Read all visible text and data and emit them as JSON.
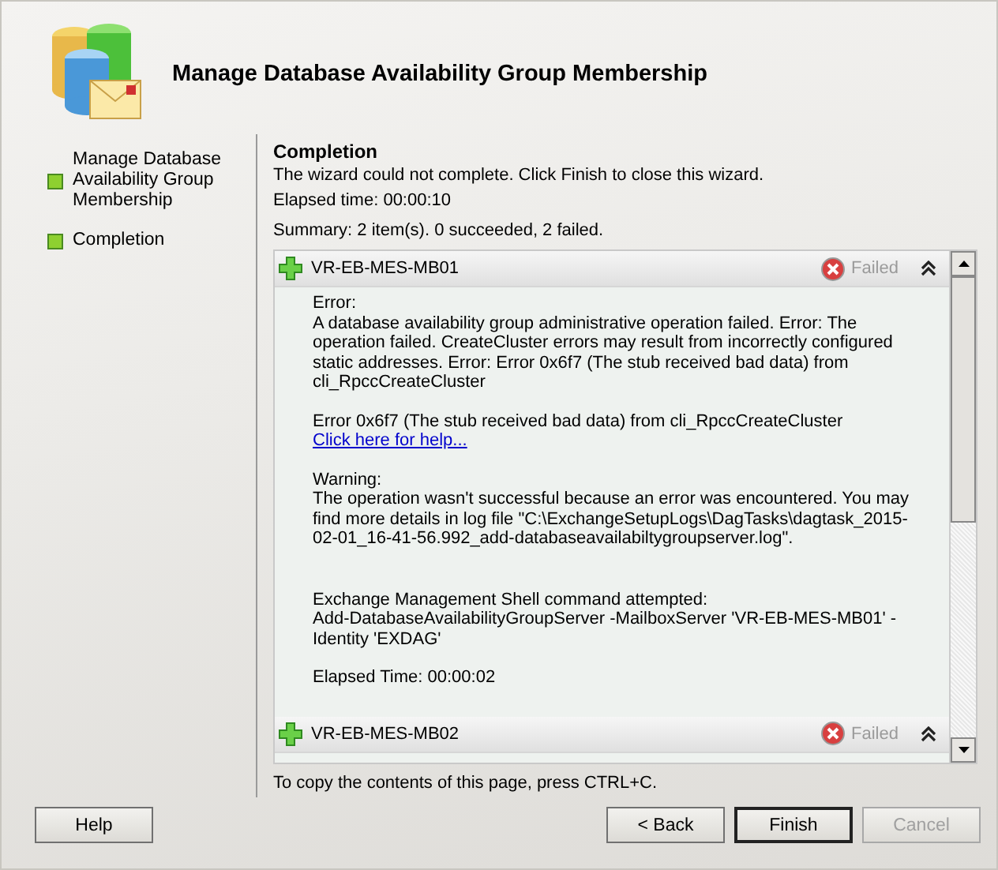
{
  "window": {
    "title": "Manage Database Availability Group Membership"
  },
  "steps": [
    {
      "label": "Manage Database Availability Group Membership",
      "completed": true
    },
    {
      "label": "Completion",
      "completed": true
    }
  ],
  "page": {
    "heading": "Completion",
    "message": "The wizard could not complete. Click Finish to close this wizard.",
    "elapsed": "Elapsed time: 00:00:10",
    "summary": "Summary: 2 item(s). 0 succeeded, 2 failed."
  },
  "results": [
    {
      "name": "VR-EB-MES-MB01",
      "status": "Failed",
      "expanded": true,
      "paragraphs": [
        [
          {
            "kind": "text",
            "text": "Error:"
          },
          {
            "kind": "text",
            "text": "A database availability group administrative operation failed. Error: The operation failed. CreateCluster errors may result from incorrectly configured static addresses. Error: Error 0x6f7 (The stub received bad data) from cli_RpccCreateCluster"
          }
        ],
        [
          {
            "kind": "text",
            "text": "Error 0x6f7 (The stub received bad data) from cli_RpccCreateCluster"
          },
          {
            "kind": "link",
            "text": "Click here for help..."
          }
        ],
        [
          {
            "kind": "text",
            "text": "Warning:"
          },
          {
            "kind": "text",
            "text": "The operation wasn't successful because an error was encountered. You may find more details in log file \"C:\\ExchangeSetupLogs\\DagTasks\\dagtask_2015-02-01_16-41-56.992_add-databaseavailabiltygroupserver.log\"."
          }
        ],
        [
          {
            "kind": "text",
            "text": "Exchange Management Shell command attempted:"
          },
          {
            "kind": "text",
            "text": "Add-DatabaseAvailabilityGroupServer -MailboxServer 'VR-EB-MES-MB01' -Identity 'EXDAG'"
          }
        ],
        [
          {
            "kind": "text",
            "text": "Elapsed Time: 00:00:02"
          }
        ]
      ]
    },
    {
      "name": "VR-EB-MES-MB02",
      "status": "Failed",
      "expanded": true
    }
  ],
  "copy_hint": "To copy the contents of this page, press CTRL+C.",
  "buttons": [
    {
      "label": "Help",
      "disabled": false,
      "default": false
    },
    {
      "label": "< Back",
      "disabled": false,
      "default": false
    },
    {
      "label": "Finish",
      "disabled": false,
      "default": true
    },
    {
      "label": "Cancel",
      "disabled": true,
      "default": false
    }
  ]
}
